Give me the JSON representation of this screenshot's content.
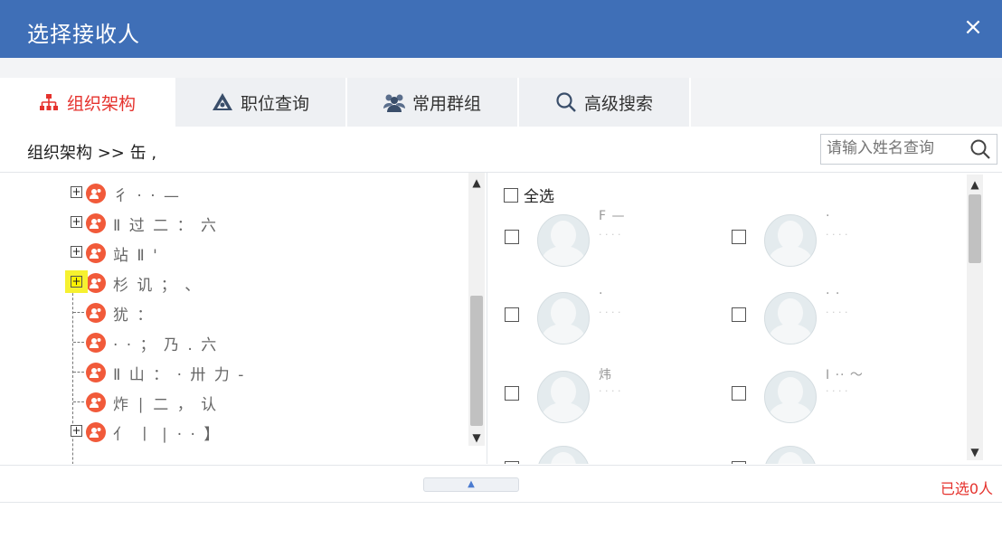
{
  "dialog": {
    "title": "选择接收人",
    "close_symbol": "×"
  },
  "tabs": [
    {
      "label": "组织架构",
      "icon": "org-chart-icon",
      "active": true
    },
    {
      "label": "职位查询",
      "icon": "position-icon",
      "active": false
    },
    {
      "label": "常用群组",
      "icon": "group-icon",
      "active": false
    },
    {
      "label": "高级搜索",
      "icon": "search-icon",
      "active": false
    }
  ],
  "breadcrumb": "组织架构 >> 缶 ,",
  "search": {
    "placeholder": "请输入姓名查询",
    "value": ""
  },
  "tree": {
    "nodes": [
      {
        "label": "彳 · · —",
        "expandable": true
      },
      {
        "label": "Ⅱ 过 二 ： 六",
        "expandable": true
      },
      {
        "label": "站 Ⅱ '",
        "expandable": true
      },
      {
        "label": "杉 讥 ； 、",
        "expandable": true,
        "highlighted": true
      },
      {
        "label": "犹 ：",
        "expandable": false
      },
      {
        "label": "· · ； 乃 . 六",
        "expandable": false
      },
      {
        "label": "Ⅱ 山 ： · 卅 力 -",
        "expandable": false
      },
      {
        "label": "炸 ∣ 二 ， 认",
        "expandable": false
      },
      {
        "label": "亻 丨 ∣ · · 】",
        "expandable": true
      }
    ]
  },
  "people": {
    "select_all_label": "全选",
    "cards": [
      {
        "name": "F —",
        "dept": "· · · ·"
      },
      {
        "name": "·",
        "dept": "· · · ·"
      },
      {
        "name": "·",
        "dept": "· · · ·"
      },
      {
        "name": "· ·",
        "dept": "· · · ·"
      },
      {
        "name": "炜",
        "dept": "· · · ·"
      },
      {
        "name": "Ⅰ ·· ～",
        "dept": "· · · ·"
      },
      {
        "name": "",
        "dept": ""
      },
      {
        "name": "",
        "dept": ""
      }
    ]
  },
  "footer": {
    "collapse_symbol": "▲",
    "selected_count": "已选0人"
  },
  "colors": {
    "header": "#3f6fb7",
    "accent_red": "#e5322d",
    "node_icon": "#f15a3a",
    "highlight": "#fff200"
  }
}
